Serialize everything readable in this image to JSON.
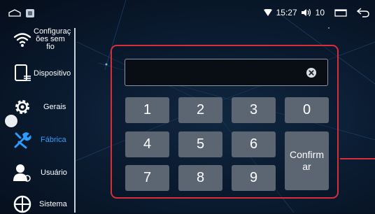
{
  "status_bar": {
    "time": "15:27",
    "volume": "10"
  },
  "sidebar": {
    "items": [
      {
        "label": "Configuraç ões sem fio",
        "icon": "wifi-icon"
      },
      {
        "label": "Dispositivo",
        "icon": "device-icon"
      },
      {
        "label": "Gerais",
        "icon": "gear-icon"
      },
      {
        "label": "Fábrica",
        "icon": "tools-icon",
        "active": true
      },
      {
        "label": "Usuário",
        "icon": "user-icon"
      },
      {
        "label": "Sistema",
        "icon": "system-icon"
      }
    ]
  },
  "keypad": {
    "input_value": "",
    "keys": [
      "1",
      "2",
      "3",
      "0",
      "4",
      "5",
      "6",
      "7",
      "8",
      "9"
    ],
    "confirm_label": "Confirm ar"
  },
  "colors": {
    "accent": "#2e9bff",
    "highlight_border": "#d92d3a",
    "key_bg": "#5c6673"
  }
}
